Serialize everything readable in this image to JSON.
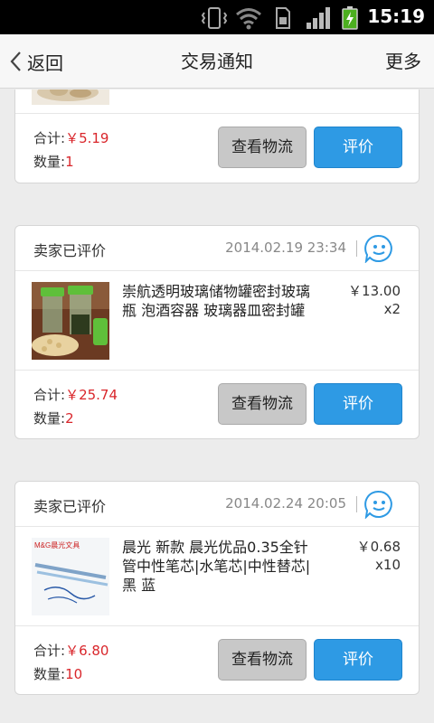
{
  "status_bar": {
    "time": "15:19",
    "icons": [
      "vibrate-icon",
      "wifi-icon",
      "sim-icon",
      "signal-icon",
      "battery-charging-icon"
    ]
  },
  "header": {
    "back_label": "返回",
    "title": "交易通知",
    "more_label": "更多"
  },
  "labels": {
    "total": "合计:",
    "qty": "数量:",
    "logistics_button": "查看物流",
    "review_button": "评价"
  },
  "orders": [
    {
      "total": "￥5.19",
      "quantity": "1"
    },
    {
      "status": "卖家已评价",
      "date": "2014.02.19 23:34",
      "item_title": "崇航透明玻璃储物罐密封玻璃瓶 泡酒容器 玻璃器皿密封罐",
      "unit_price": "￥13.00",
      "item_qty": "x2",
      "total": "￥25.74",
      "quantity": "2"
    },
    {
      "status": "卖家已评价",
      "date": "2014.02.24 20:05",
      "item_title": "晨光 新款 晨光优品0.35全针管中性笔芯|水笔芯|中性替芯| 黑 蓝",
      "unit_price": "￥0.68",
      "item_qty": "x10",
      "thumb_brand": "M&G晨光文具",
      "total": "￥6.80",
      "quantity": "10"
    }
  ],
  "colors": {
    "accent_blue": "#2e9ae4",
    "price_red": "#d9262b",
    "secondary_button": "#c8c8c8"
  }
}
